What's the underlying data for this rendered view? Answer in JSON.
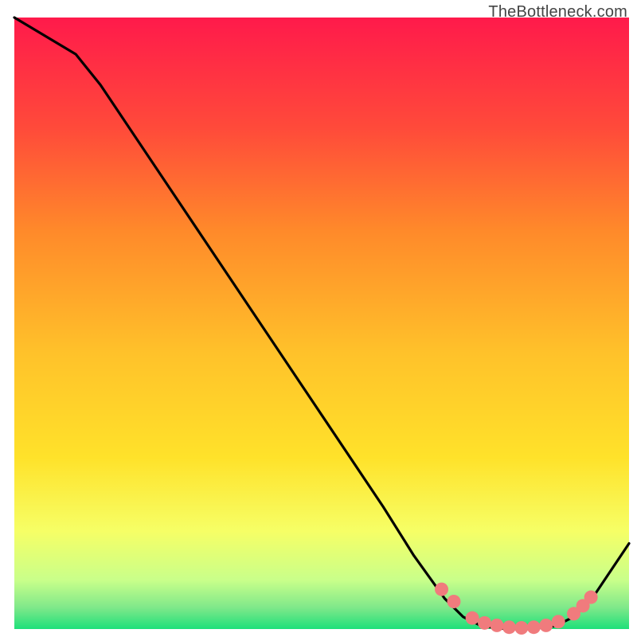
{
  "watermark": "TheBottleneck.com",
  "colors": {
    "curve": "#000000",
    "dot_fill": "#f07b7d",
    "dot_stroke": "#c94a4c",
    "gradient_top": "#ff1a4b",
    "gradient_mid1": "#ff8a2a",
    "gradient_mid2": "#ffe22a",
    "gradient_mid3": "#f6ff66",
    "gradient_mid4": "#c9ff8a",
    "gradient_bot": "#1ee07a",
    "frame_bg": "#ffffff"
  },
  "chart_data": {
    "type": "line",
    "title": "",
    "xlabel": "",
    "ylabel": "",
    "xlim": [
      0,
      100
    ],
    "ylim": [
      0,
      100
    ],
    "curve": [
      {
        "x": 0,
        "y": 100
      },
      {
        "x": 10,
        "y": 94
      },
      {
        "x": 14,
        "y": 89
      },
      {
        "x": 20,
        "y": 80
      },
      {
        "x": 30,
        "y": 65
      },
      {
        "x": 40,
        "y": 50
      },
      {
        "x": 50,
        "y": 35
      },
      {
        "x": 60,
        "y": 20
      },
      {
        "x": 65,
        "y": 12
      },
      {
        "x": 70,
        "y": 5
      },
      {
        "x": 73,
        "y": 2
      },
      {
        "x": 76,
        "y": 0.5
      },
      {
        "x": 80,
        "y": 0
      },
      {
        "x": 84,
        "y": 0
      },
      {
        "x": 88,
        "y": 0.5
      },
      {
        "x": 91,
        "y": 2
      },
      {
        "x": 94,
        "y": 5
      },
      {
        "x": 100,
        "y": 14
      }
    ],
    "dots": [
      {
        "x": 69.5,
        "y": 6.5
      },
      {
        "x": 71.5,
        "y": 4.5
      },
      {
        "x": 74.5,
        "y": 1.8
      },
      {
        "x": 76.5,
        "y": 1.0
      },
      {
        "x": 78.5,
        "y": 0.6
      },
      {
        "x": 80.5,
        "y": 0.3
      },
      {
        "x": 82.5,
        "y": 0.2
      },
      {
        "x": 84.5,
        "y": 0.3
      },
      {
        "x": 86.5,
        "y": 0.6
      },
      {
        "x": 88.5,
        "y": 1.2
      },
      {
        "x": 91.0,
        "y": 2.5
      },
      {
        "x": 92.5,
        "y": 3.8
      },
      {
        "x": 93.8,
        "y": 5.2
      }
    ]
  }
}
